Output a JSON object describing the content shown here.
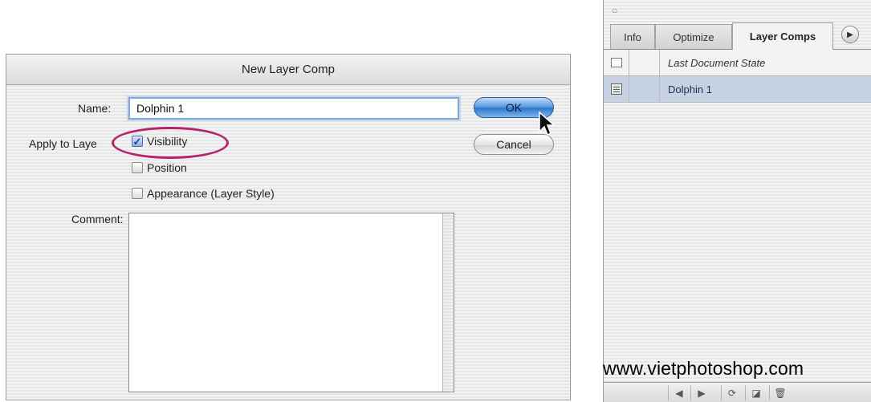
{
  "dialog": {
    "title": "New Layer Comp",
    "name_label": "Name:",
    "name_value": "Dolphin 1",
    "apply_label": "Apply to Laye",
    "visibility_label": "Visibility",
    "visibility_checked": true,
    "position_label": "Position",
    "position_checked": false,
    "appearance_label": "Appearance (Layer Style)",
    "appearance_checked": false,
    "comment_label": "Comment:",
    "comment_value": "",
    "ok_label": "OK",
    "cancel_label": "Cancel",
    "highlight_color": "#b5246a"
  },
  "panel": {
    "tabs": [
      {
        "label": "Info",
        "active": false
      },
      {
        "label": "Optimize",
        "active": false
      },
      {
        "label": "Layer Comps",
        "active": true
      }
    ],
    "menu_icon": "triangle-right-icon",
    "comps": [
      {
        "label": "Last Document State",
        "selected": false
      },
      {
        "label": "Dolphin 1",
        "selected": true
      }
    ],
    "toolbar_icons": [
      "previous-icon",
      "next-icon",
      "update-icon",
      "new-comp-icon",
      "trash-icon"
    ],
    "selection_color": "#c6d1e4"
  },
  "watermark": "www.vietphotoshop.com"
}
